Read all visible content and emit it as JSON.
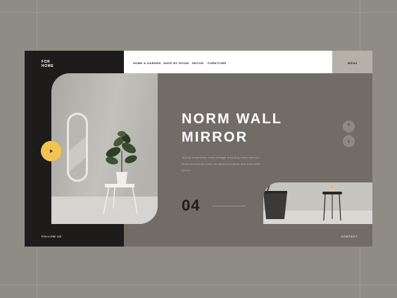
{
  "brand": {
    "name": "FOR\nHOME"
  },
  "nav": {
    "items": [
      "HOME & GARDEN",
      "SHOP BY ROOM",
      "DECOR",
      "FURNITURE"
    ],
    "menu_label": "MENU"
  },
  "hero": {
    "title": "NORM WALL\nMIRROR",
    "description": "Taking inspiration from vintage dressing room mirrors, Norm Architects have designed a simple and neat wall mirror.",
    "slide_number": "04"
  },
  "footer": {
    "follow_label": "FOLLOW US",
    "contact_label": "CONTACT"
  },
  "icons": {
    "play": "play-icon",
    "up": "chevron-up-icon",
    "down": "chevron-down-icon"
  },
  "colors": {
    "background": "#8e8c85",
    "panel_dark": "#1d1c1b",
    "panel_taupe": "#716d66",
    "accent_yellow": "#f3c34f",
    "menu_bg": "#b6b1a8"
  }
}
